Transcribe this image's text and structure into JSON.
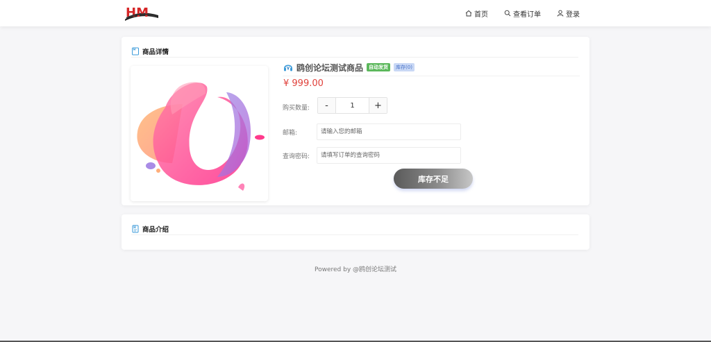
{
  "header": {
    "logo_text": "HM",
    "nav": {
      "home": "首页",
      "orders": "查看订单",
      "login": "登录"
    }
  },
  "detail": {
    "section_title": "商品详情",
    "product_name": "鸥创论坛测试商品",
    "badge_delivery": "自动发货",
    "badge_stock": "库存(0)",
    "price": "¥ 999.00",
    "quantity_label": "购买数量:",
    "quantity_minus": "-",
    "quantity_value": "1",
    "quantity_plus": "+",
    "email_label": "邮箱:",
    "email_placeholder": "请输入您的邮箱",
    "password_label": "查询密码:",
    "password_placeholder": "请填写订单的查询密码",
    "submit_label": "库存不足"
  },
  "intro": {
    "section_title": "商品介绍"
  },
  "footer": {
    "text": "Powered by @鸥创论坛测试"
  },
  "colors": {
    "price": "#e0413b",
    "badge_delivery": "#5cb85c",
    "badge_stock": "#c9d8f5",
    "accent": "#4b74c9"
  }
}
